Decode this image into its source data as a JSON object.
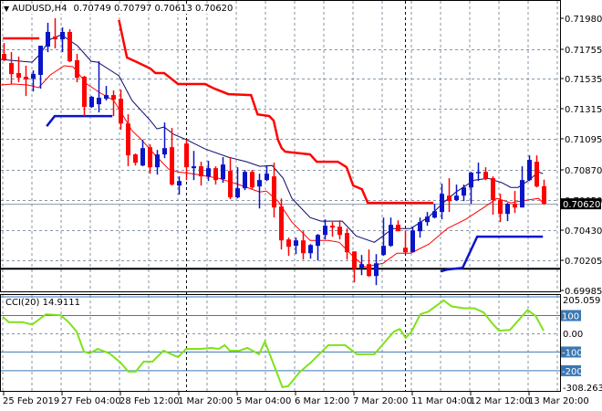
{
  "header": {
    "symbol_label": "AUDUSD,H4",
    "ohlc": "0.70749 0.70797 0.70613 0.70620"
  },
  "cci_header": {
    "label": "CCI(20)",
    "value": "14.9111"
  },
  "colors": {
    "bull": "#0a14c8",
    "bear": "#ff0000",
    "ma_slow": "#0a0a6e",
    "ma_fast": "#ff0000",
    "cci": "#7fe21c",
    "grid": "#8796a6",
    "level": "#3a78b4"
  },
  "chart_data": [
    {
      "type": "candlestick",
      "title": "AUDUSD,H4",
      "ylim": [
        0.69985,
        0.7198
      ],
      "y_ticks": [
        "0.71980",
        "0.71755",
        "0.71535",
        "0.71315",
        "0.71095",
        "0.70870",
        "0.70650",
        "0.70430",
        "0.70205",
        "0.69985"
      ],
      "current_price_label": "0.70620",
      "x_tick_labels": [
        {
          "index": 1,
          "label": "25 Feb 2019"
        },
        {
          "index": 9,
          "label": "27 Feb 04:00"
        },
        {
          "index": 17,
          "label": "28 Feb 12:00"
        },
        {
          "index": 25,
          "label": "1 Mar 20:00"
        },
        {
          "index": 33,
          "label": "5 Mar 04:00"
        },
        {
          "index": 41,
          "label": "6 Mar 12:00"
        },
        {
          "index": 49,
          "label": "7 Mar 20:00"
        },
        {
          "index": 57,
          "label": "11 Mar 04:00"
        },
        {
          "index": 65,
          "label": "12 Mar 12:00"
        },
        {
          "index": 73,
          "label": "13 Mar 20:00"
        }
      ],
      "period_separators": [
        26,
        56
      ],
      "horizontal_lines": [
        0.70144
      ],
      "ohlc": [
        [
          0.71719,
          0.71799,
          0.71665,
          0.71678
        ],
        [
          0.71652,
          0.71732,
          0.71498,
          0.71571
        ],
        [
          0.71578,
          0.71699,
          0.71511,
          0.71544
        ],
        [
          0.71551,
          0.71632,
          0.7141,
          0.71531
        ],
        [
          0.71538,
          0.71598,
          0.71444,
          0.71571
        ],
        [
          0.71565,
          0.71779,
          0.71464,
          0.71779
        ],
        [
          0.71772,
          0.71947,
          0.71732,
          0.7188
        ],
        [
          0.71846,
          0.7198,
          0.71759,
          0.71826
        ],
        [
          0.71826,
          0.71913,
          0.71732,
          0.7188
        ],
        [
          0.7188,
          0.719,
          0.71658,
          0.71665
        ],
        [
          0.71672,
          0.71719,
          0.71511,
          0.71544
        ],
        [
          0.71551,
          0.71558,
          0.71263,
          0.7133
        ],
        [
          0.7133,
          0.7141,
          0.71323,
          0.71404
        ],
        [
          0.7135,
          0.71665,
          0.7129,
          0.71397
        ],
        [
          0.7139,
          0.71484,
          0.71377,
          0.71417
        ],
        [
          0.71417,
          0.71451,
          0.71263,
          0.71384
        ],
        [
          0.7139,
          0.71457,
          0.71163,
          0.71209
        ],
        [
          0.71209,
          0.71276,
          0.70895,
          0.70975
        ],
        [
          0.70982,
          0.70989,
          0.70901,
          0.70921
        ],
        [
          0.70901,
          0.71089,
          0.70895,
          0.71028
        ],
        [
          0.71035,
          0.71055,
          0.70841,
          0.70888
        ],
        [
          0.70888,
          0.71015,
          0.70834,
          0.70982
        ],
        [
          0.70982,
          0.71216,
          0.70955,
          0.71028
        ],
        [
          0.71035,
          0.71176,
          0.70754,
          0.70761
        ],
        [
          0.70754,
          0.70821,
          0.70687,
          0.70787
        ],
        [
          0.71062,
          0.71089,
          0.70794,
          0.70888
        ],
        [
          0.70881,
          0.71008,
          0.70794,
          0.70895
        ],
        [
          0.70895,
          0.70928,
          0.70754,
          0.70821
        ],
        [
          0.70821,
          0.70935,
          0.70787,
          0.70881
        ],
        [
          0.70881,
          0.70895,
          0.70761,
          0.70794
        ],
        [
          0.70801,
          0.70962,
          0.70774,
          0.70908
        ],
        [
          0.70861,
          0.70962,
          0.70654,
          0.70667
        ],
        [
          0.70667,
          0.70888,
          0.7066,
          0.70734
        ],
        [
          0.70734,
          0.70868,
          0.7072,
          0.70854
        ],
        [
          0.70854,
          0.70868,
          0.70727,
          0.7074
        ],
        [
          0.70747,
          0.70841,
          0.70586,
          0.70794
        ],
        [
          0.70794,
          0.70895,
          0.70787,
          0.70841
        ],
        [
          0.70821,
          0.70922,
          0.7052,
          0.70593
        ],
        [
          0.706,
          0.7066,
          0.70285,
          0.70352
        ],
        [
          0.70359,
          0.70372,
          0.70238,
          0.70305
        ],
        [
          0.70312,
          0.70372,
          0.70251,
          0.70352
        ],
        [
          0.70352,
          0.70419,
          0.70211,
          0.70258
        ],
        [
          0.70258,
          0.70325,
          0.70218,
          0.70318
        ],
        [
          0.70312,
          0.70399,
          0.70204,
          0.70392
        ],
        [
          0.70392,
          0.70506,
          0.70359,
          0.70459
        ],
        [
          0.70459,
          0.70486,
          0.70379,
          0.70446
        ],
        [
          0.70452,
          0.70499,
          0.70359,
          0.70392
        ],
        [
          0.70406,
          0.70439,
          0.70211,
          0.70265
        ],
        [
          0.70271,
          0.70271,
          0.70044,
          0.70144
        ],
        [
          0.70151,
          0.70245,
          0.70097,
          0.70178
        ],
        [
          0.70178,
          0.70285,
          0.70084,
          0.70091
        ],
        [
          0.70091,
          0.70251,
          0.70024,
          0.70184
        ],
        [
          0.70245,
          0.70519,
          0.70238,
          0.70312
        ],
        [
          0.70312,
          0.70519,
          0.70305,
          0.70466
        ],
        [
          0.70466,
          0.70499,
          0.70419,
          0.70419
        ],
        [
          0.70298,
          0.70425,
          0.70258,
          0.70265
        ],
        [
          0.70265,
          0.70452,
          0.70265,
          0.70425
        ],
        [
          0.70419,
          0.70519,
          0.70372,
          0.70486
        ],
        [
          0.70486,
          0.7056,
          0.70459,
          0.70526
        ],
        [
          0.70519,
          0.7062,
          0.70513,
          0.70566
        ],
        [
          0.7056,
          0.70767,
          0.70506,
          0.70693
        ],
        [
          0.7068,
          0.70808,
          0.7056,
          0.7064
        ],
        [
          0.70647,
          0.70761,
          0.7064,
          0.7068
        ],
        [
          0.7068,
          0.70761,
          0.7064,
          0.7074
        ],
        [
          0.7074,
          0.70854,
          0.7062,
          0.70848
        ],
        [
          0.70848,
          0.70922,
          0.70787,
          0.70854
        ],
        [
          0.70854,
          0.70888,
          0.70794,
          0.70801
        ],
        [
          0.70808,
          0.70821,
          0.7054,
          0.70647
        ],
        [
          0.70647,
          0.70694,
          0.70486,
          0.70546
        ],
        [
          0.70546,
          0.70627,
          0.70493,
          0.7062
        ],
        [
          0.7062,
          0.70714,
          0.70553,
          0.70593
        ],
        [
          0.70593,
          0.70895,
          0.70593,
          0.70794
        ],
        [
          0.70794,
          0.70975,
          0.70787,
          0.70942
        ],
        [
          0.70928,
          0.70975,
          0.7074,
          0.70747
        ],
        [
          0.70749,
          0.70797,
          0.70613,
          0.7062
        ]
      ],
      "ma_slow": [
        [
          0.5,
          0.71679
        ],
        [
          4.9,
          0.71658
        ],
        [
          5.9,
          0.71712
        ],
        [
          7.4,
          0.71826
        ],
        [
          8.9,
          0.71859
        ],
        [
          11.1,
          0.71779
        ],
        [
          13,
          0.71665
        ],
        [
          13.9,
          0.71658
        ],
        [
          16.8,
          0.71558
        ],
        [
          18.6,
          0.71377
        ],
        [
          21.1,
          0.7123
        ],
        [
          22,
          0.71169
        ],
        [
          23,
          0.71183
        ],
        [
          24.3,
          0.71129
        ],
        [
          26.1,
          0.71089
        ],
        [
          28.6,
          0.71022
        ],
        [
          31.8,
          0.70962
        ],
        [
          34.3,
          0.70928
        ],
        [
          36.1,
          0.70895
        ],
        [
          37.8,
          0.70901
        ],
        [
          39.3,
          0.70807
        ],
        [
          40.5,
          0.7066
        ],
        [
          43,
          0.70519
        ],
        [
          44.5,
          0.70493
        ],
        [
          47.4,
          0.70493
        ],
        [
          49.3,
          0.70385
        ],
        [
          51.8,
          0.70338
        ],
        [
          53,
          0.70385
        ],
        [
          54.3,
          0.70439
        ],
        [
          56.8,
          0.70439
        ],
        [
          59.3,
          0.70526
        ],
        [
          61.1,
          0.7062
        ],
        [
          63,
          0.70707
        ],
        [
          65.5,
          0.70794
        ],
        [
          67.4,
          0.70807
        ],
        [
          69.3,
          0.70774
        ],
        [
          70.5,
          0.7074
        ],
        [
          71.5,
          0.7074
        ],
        [
          73,
          0.70794
        ],
        [
          74.3,
          0.70854
        ],
        [
          74.9,
          0.70841
        ]
      ],
      "ma_fast": [
        [
          0.5,
          0.71491
        ],
        [
          2.4,
          0.71498
        ],
        [
          4.3,
          0.71491
        ],
        [
          5.8,
          0.71471
        ],
        [
          7.4,
          0.71565
        ],
        [
          9.3,
          0.71632
        ],
        [
          10.5,
          0.71625
        ],
        [
          12.4,
          0.71498
        ],
        [
          14.3,
          0.71431
        ],
        [
          16.1,
          0.71377
        ],
        [
          17.4,
          0.71263
        ],
        [
          18.6,
          0.71156
        ],
        [
          19.9,
          0.71089
        ],
        [
          21.8,
          0.70975
        ],
        [
          23.6,
          0.70875
        ],
        [
          24.9,
          0.70854
        ],
        [
          26.8,
          0.70841
        ],
        [
          30.5,
          0.70807
        ],
        [
          33.6,
          0.70754
        ],
        [
          36.1,
          0.70707
        ],
        [
          37,
          0.70714
        ],
        [
          38.6,
          0.7064
        ],
        [
          40.5,
          0.70486
        ],
        [
          43,
          0.70352
        ],
        [
          45.5,
          0.70352
        ],
        [
          47,
          0.70338
        ],
        [
          48.6,
          0.70251
        ],
        [
          50.5,
          0.70158
        ],
        [
          53,
          0.70184
        ],
        [
          54.9,
          0.70258
        ],
        [
          56.8,
          0.70258
        ],
        [
          59.3,
          0.70325
        ],
        [
          61.8,
          0.70439
        ],
        [
          64.3,
          0.70506
        ],
        [
          66.8,
          0.70593
        ],
        [
          68.6,
          0.7066
        ],
        [
          70.5,
          0.70627
        ],
        [
          71.8,
          0.7064
        ],
        [
          74.3,
          0.7066
        ],
        [
          75.1,
          0.7062
        ]
      ],
      "upper_channel": [
        [
          [
            0.9,
            0.71833
          ],
          [
            5.9,
            0.71833
          ]
        ],
        [
          [
            16.8,
            0.71967
          ],
          [
            17.9,
            0.71692
          ],
          [
            19.3,
            0.71658
          ],
          [
            21.1,
            0.71612
          ],
          [
            21.8,
            0.71578
          ],
          [
            23,
            0.71578
          ],
          [
            24.9,
            0.71498
          ],
          [
            28.6,
            0.71498
          ],
          [
            29.9,
            0.71464
          ],
          [
            31.8,
            0.71424
          ],
          [
            34.9,
            0.71417
          ],
          [
            35.8,
            0.71276
          ],
          [
            37.4,
            0.71263
          ],
          [
            38,
            0.7123
          ],
          [
            38.6,
            0.71089
          ],
          [
            39.1,
            0.71029
          ],
          [
            39.6,
            0.71002
          ],
          [
            43,
            0.70982
          ],
          [
            43.9,
            0.70928
          ],
          [
            46.8,
            0.70928
          ],
          [
            48,
            0.70888
          ],
          [
            48.9,
            0.70754
          ],
          [
            50.1,
            0.70727
          ],
          [
            50.9,
            0.70627
          ],
          [
            59.9,
            0.70627
          ]
        ]
      ],
      "lower_channel": [
        [
          [
            6.9,
            0.71189
          ],
          [
            8,
            0.71263
          ],
          [
            15.9,
            0.71263
          ]
        ],
        [
          [
            60.9,
            0.70124
          ],
          [
            61.8,
            0.70138
          ],
          [
            63.9,
            0.70151
          ],
          [
            65.9,
            0.70379
          ],
          [
            74.9,
            0.70379
          ]
        ]
      ]
    },
    {
      "type": "line",
      "title": "CCI(20)",
      "ylim": [
        -308.2639,
        205.059
      ],
      "y_ticks": [
        "205.059",
        "100",
        "0.00",
        "-100",
        "-200",
        "-308.2639"
      ],
      "levels": [
        100,
        -100,
        -200
      ],
      "points": [
        [
          0.9,
          93
        ],
        [
          1.7,
          63
        ],
        [
          3.6,
          63
        ],
        [
          4.9,
          49
        ],
        [
          6.8,
          107
        ],
        [
          8.8,
          102
        ],
        [
          9.9,
          63
        ],
        [
          11,
          10
        ],
        [
          12,
          -98
        ],
        [
          12.8,
          -107
        ],
        [
          13.9,
          -83
        ],
        [
          15.5,
          -107
        ],
        [
          17,
          -156
        ],
        [
          18.1,
          -205
        ],
        [
          19.1,
          -205
        ],
        [
          20.2,
          -151
        ],
        [
          21.4,
          -151
        ],
        [
          22.9,
          -93
        ],
        [
          24.9,
          -127
        ],
        [
          26,
          -83
        ],
        [
          28.1,
          -83
        ],
        [
          29.4,
          -78
        ],
        [
          30.5,
          -83
        ],
        [
          31.3,
          -63
        ],
        [
          32,
          -93
        ],
        [
          33.3,
          -93
        ],
        [
          34.4,
          -78
        ],
        [
          36,
          -112
        ],
        [
          36.8,
          -44
        ],
        [
          39.2,
          -288
        ],
        [
          40,
          -283
        ],
        [
          41.5,
          -210
        ],
        [
          43.1,
          -156
        ],
        [
          45.5,
          -63
        ],
        [
          47.8,
          -63
        ],
        [
          49.4,
          -112
        ],
        [
          51.8,
          -112
        ],
        [
          53.4,
          -39
        ],
        [
          54.5,
          10
        ],
        [
          55.3,
          24
        ],
        [
          56.1,
          -24
        ],
        [
          56.9,
          10
        ],
        [
          58.1,
          107
        ],
        [
          59.2,
          122
        ],
        [
          61.3,
          185
        ],
        [
          62.4,
          151
        ],
        [
          64.1,
          141
        ],
        [
          65.5,
          141
        ],
        [
          66.8,
          117
        ],
        [
          67.9,
          59
        ],
        [
          68.9,
          15
        ],
        [
          70.4,
          20
        ],
        [
          72.8,
          132
        ],
        [
          73.9,
          98
        ],
        [
          75,
          14.9111
        ]
      ]
    }
  ]
}
